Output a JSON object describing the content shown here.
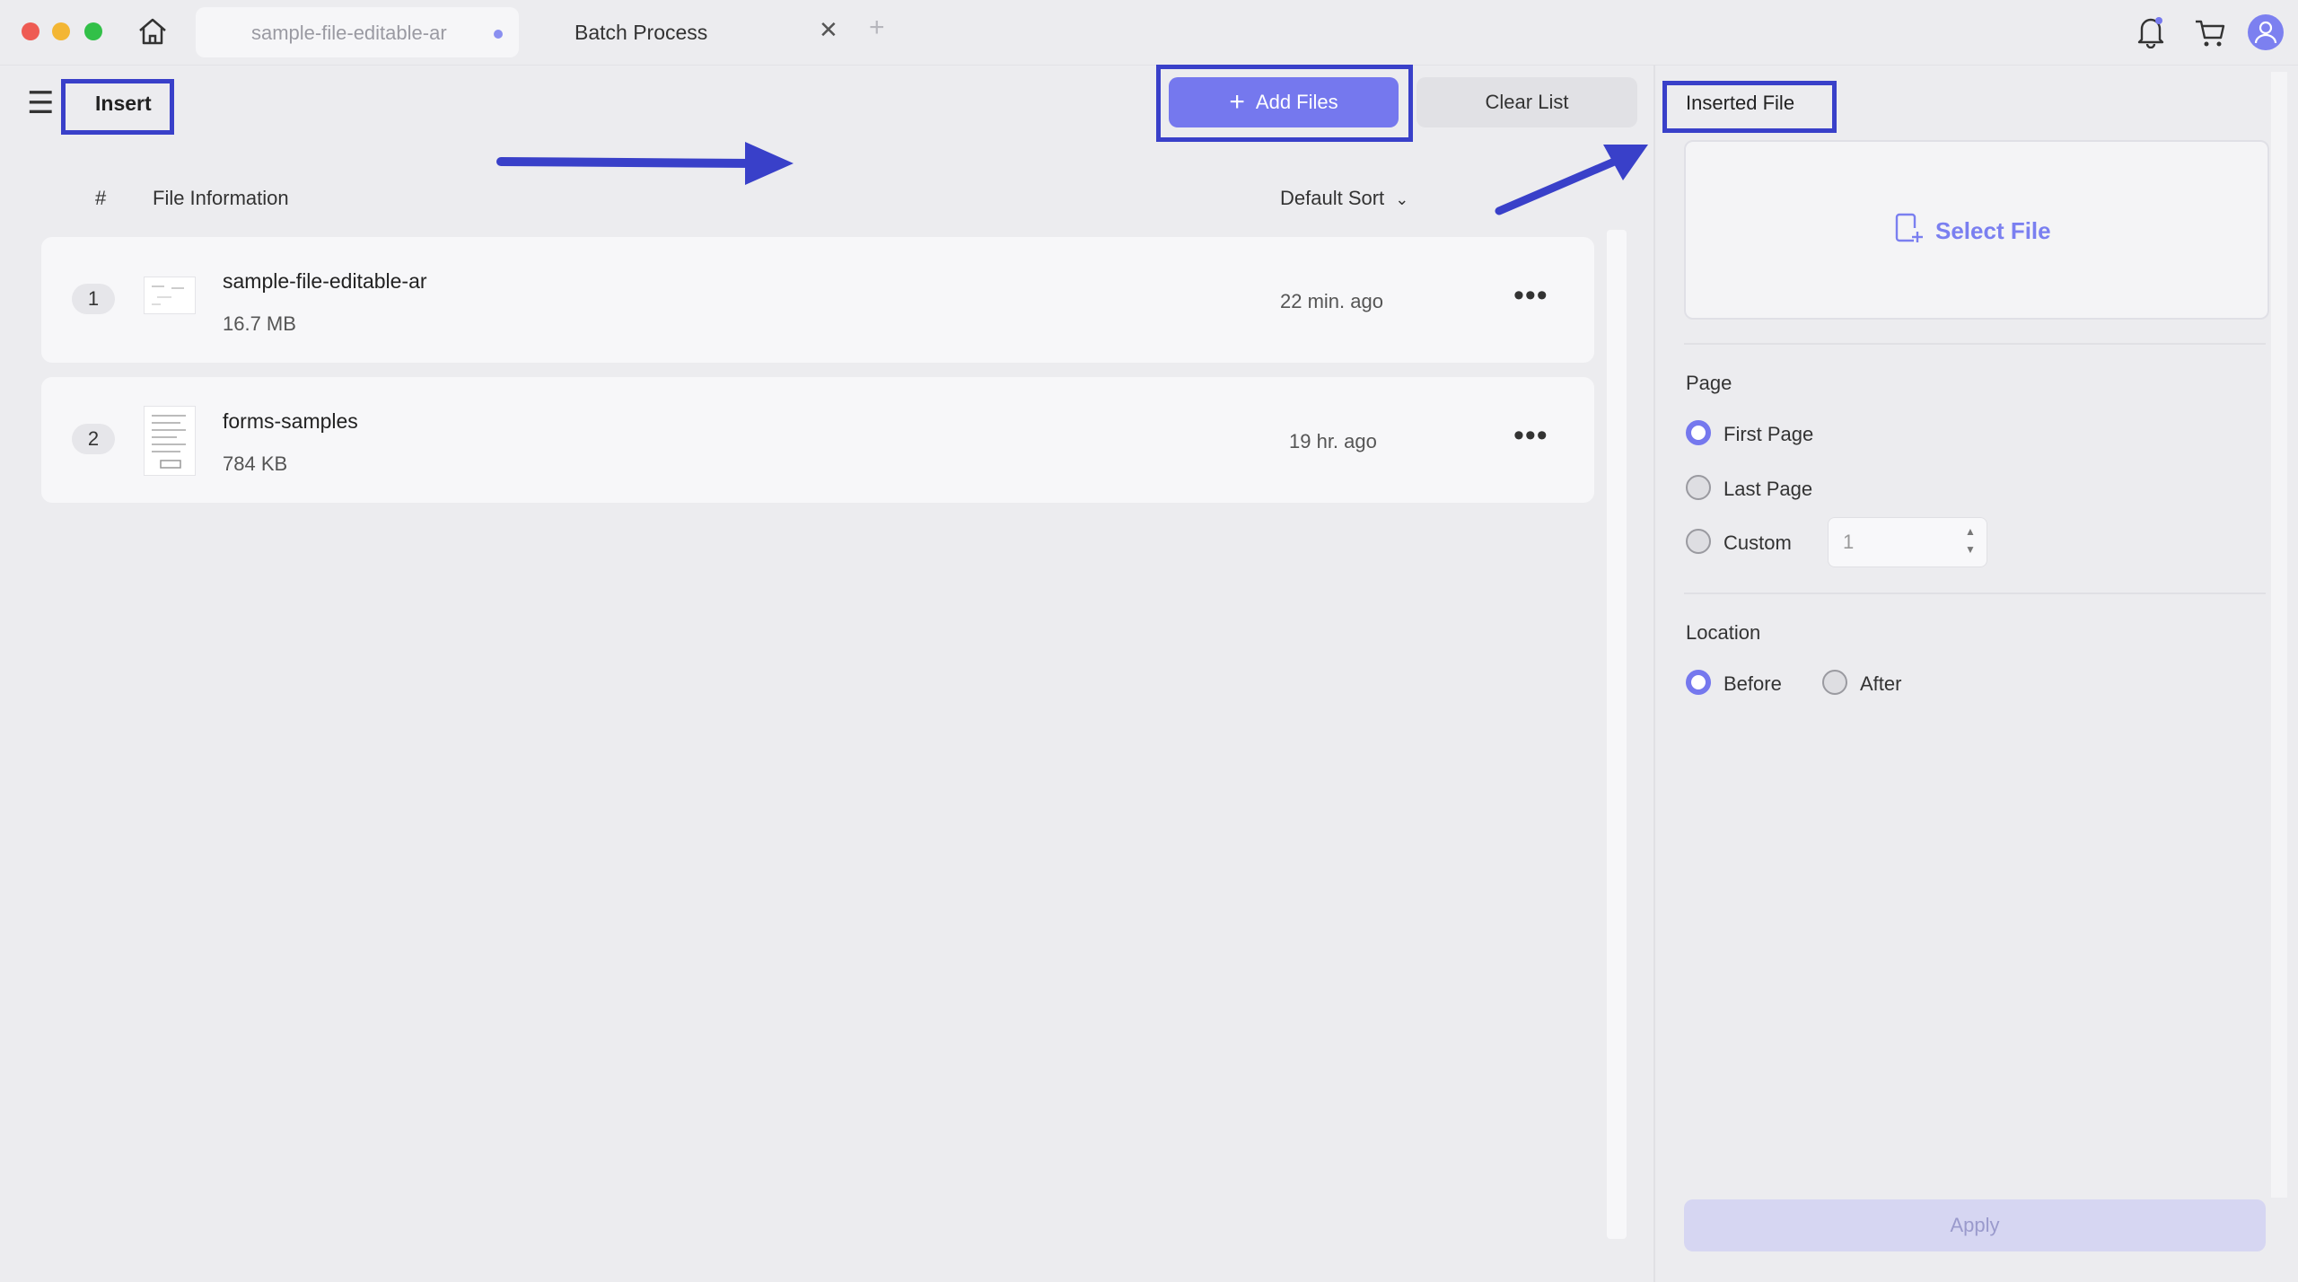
{
  "window": {
    "tabs": [
      {
        "label": "sample-file-editable-ar"
      },
      {
        "label": "Batch Process"
      }
    ]
  },
  "toolbar": {
    "insert_label": "Insert",
    "add_files_label": "Add Files",
    "clear_list_label": "Clear List"
  },
  "list_header": {
    "number_col": "#",
    "info_col": "File Information",
    "sort_label": "Default Sort"
  },
  "files": [
    {
      "index": "1",
      "name": "sample-file-editable-ar",
      "size": "16.7 MB",
      "time": "22 min. ago"
    },
    {
      "index": "2",
      "name": "forms-samples",
      "size": "784 KB",
      "time": "19 hr. ago"
    }
  ],
  "panel": {
    "title": "Inserted File",
    "select_file_label": "Select File",
    "page_section": "Page",
    "page_options": [
      "First Page",
      "Last Page",
      "Custom"
    ],
    "page_selected": "First Page",
    "custom_value": "1",
    "location_section": "Location",
    "location_options": [
      "Before",
      "After"
    ],
    "location_selected": "Before",
    "apply_label": "Apply"
  },
  "colors": {
    "accent": "#7578ee",
    "annotation": "#3940c9"
  },
  "icons": [
    "home-icon",
    "close-icon",
    "plus-icon",
    "menu-icon",
    "chevron-down-icon",
    "more-icon",
    "bell-icon",
    "cart-icon",
    "user-icon",
    "file-add-icon"
  ]
}
